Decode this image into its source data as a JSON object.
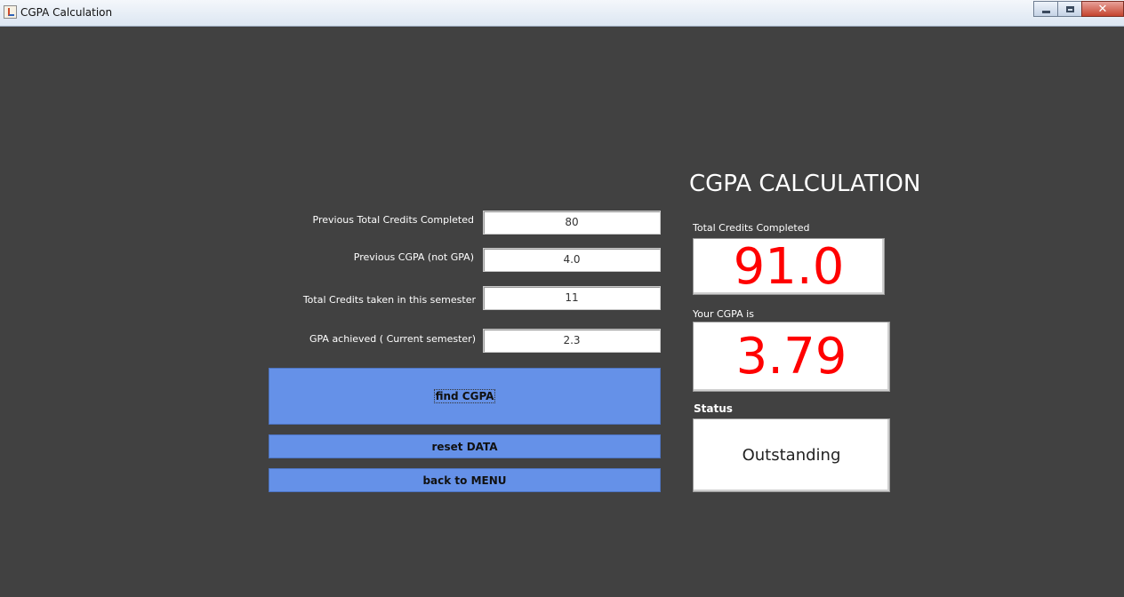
{
  "window": {
    "title": "CGPA Calculation"
  },
  "form": {
    "prev_credits_label": "Previous Total Credits Completed",
    "prev_credits_value": "80",
    "prev_cgpa_label": "Previous CGPA (not GPA)",
    "prev_cgpa_value": "4.0",
    "sem_credits_label": "Total Credits  taken in this semester",
    "sem_credits_value": "11",
    "gpa_label": "GPA achieved ( Current semester)",
    "gpa_value": "2.3"
  },
  "buttons": {
    "find": "find CGPA",
    "reset": "reset DATA",
    "back": "back to MENU"
  },
  "results": {
    "heading": "CGPA CALCULATION",
    "total_credits_label": "Total Credits Completed",
    "total_credits_value": "91.0",
    "cgpa_label": "Your CGPA is",
    "cgpa_value": "3.79",
    "status_label": "Status",
    "status_value": "Outstanding"
  },
  "colors": {
    "background": "#414141",
    "button": "#6591e8",
    "result_value": "#ff0000"
  },
  "icons": [
    "java-app-icon",
    "minimize-icon",
    "maximize-icon",
    "close-icon"
  ]
}
